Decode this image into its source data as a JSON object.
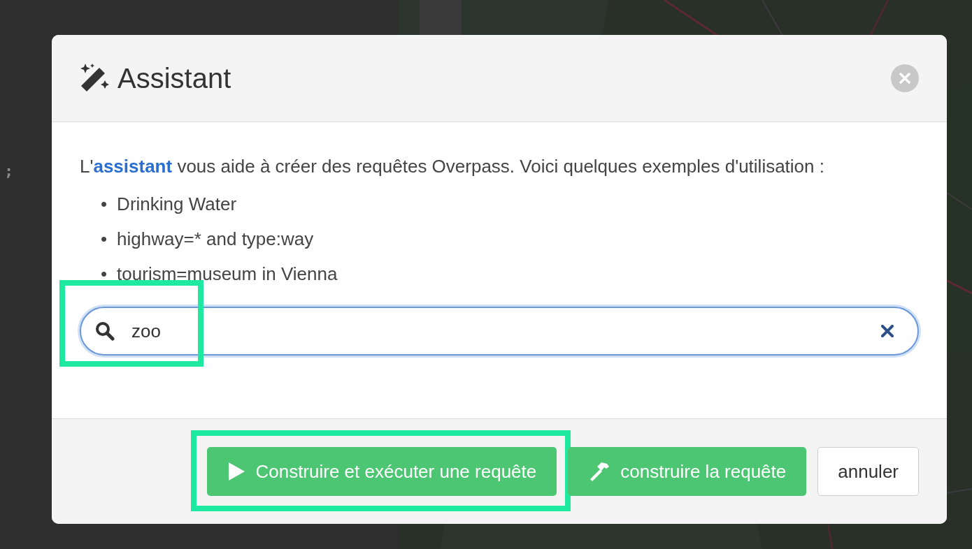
{
  "editor": {
    "text": ";"
  },
  "dialog": {
    "title": "Assistant",
    "intro": "L'**assistant** vous aide à créer des requêtes Overpass. Voici quelques exemples d'utilisation :",
    "marker": "•",
    "examples": [
      "Drinking Water",
      "highway=* and type:way",
      "tourism=museum in Vienna"
    ],
    "search": {
      "value": "zoo",
      "highlighted": true
    },
    "buttons": [
      {
        "kind": "run",
        "label": "Construire et exécuter une requête",
        "highlighted": true
      },
      {
        "kind": "build",
        "label": "construire la requête",
        "highlighted": false
      },
      {
        "kind": "cancel",
        "label": "annuler",
        "highlighted": false
      }
    ]
  }
}
